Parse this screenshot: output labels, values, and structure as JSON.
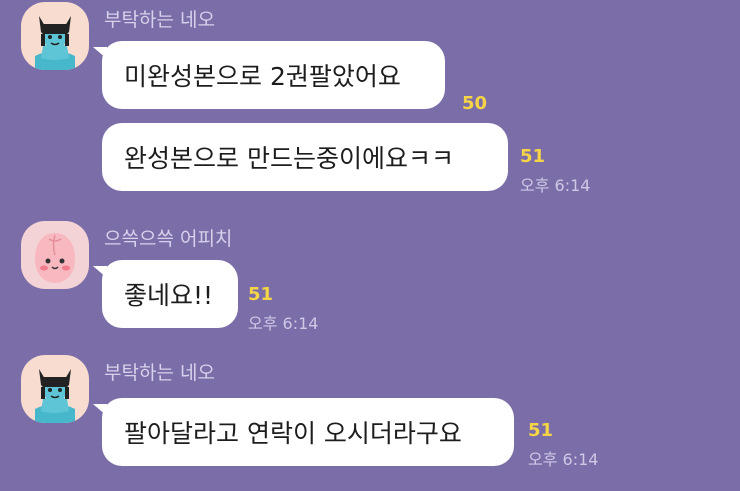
{
  "messages": [
    {
      "sender": "부탁하는 네오",
      "avatar_icon": "neo-character-icon",
      "bubbles": [
        {
          "text": "미완성본으로 2권팔았어요",
          "unread": "50",
          "time": ""
        },
        {
          "text": "완성본으로 만드는중이에요ㅋㅋ",
          "unread": "51",
          "time": "오후 6:14"
        }
      ]
    },
    {
      "sender": "으쓱으쓱 어피치",
      "avatar_icon": "apeach-character-icon",
      "bubbles": [
        {
          "text": "좋네요!!",
          "unread": "51",
          "time": "오후 6:14"
        }
      ]
    },
    {
      "sender": "부탁하는 네오",
      "avatar_icon": "neo-character-icon",
      "bubbles": [
        {
          "text": "팔아달라고 연락이 오시더라구요",
          "unread": "51",
          "time": "오후 6:14"
        }
      ]
    }
  ],
  "colors": {
    "background": "#7b6ea8",
    "bubble": "#ffffff",
    "unread": "#f5d445",
    "sender_text": "#d7d1ec"
  }
}
